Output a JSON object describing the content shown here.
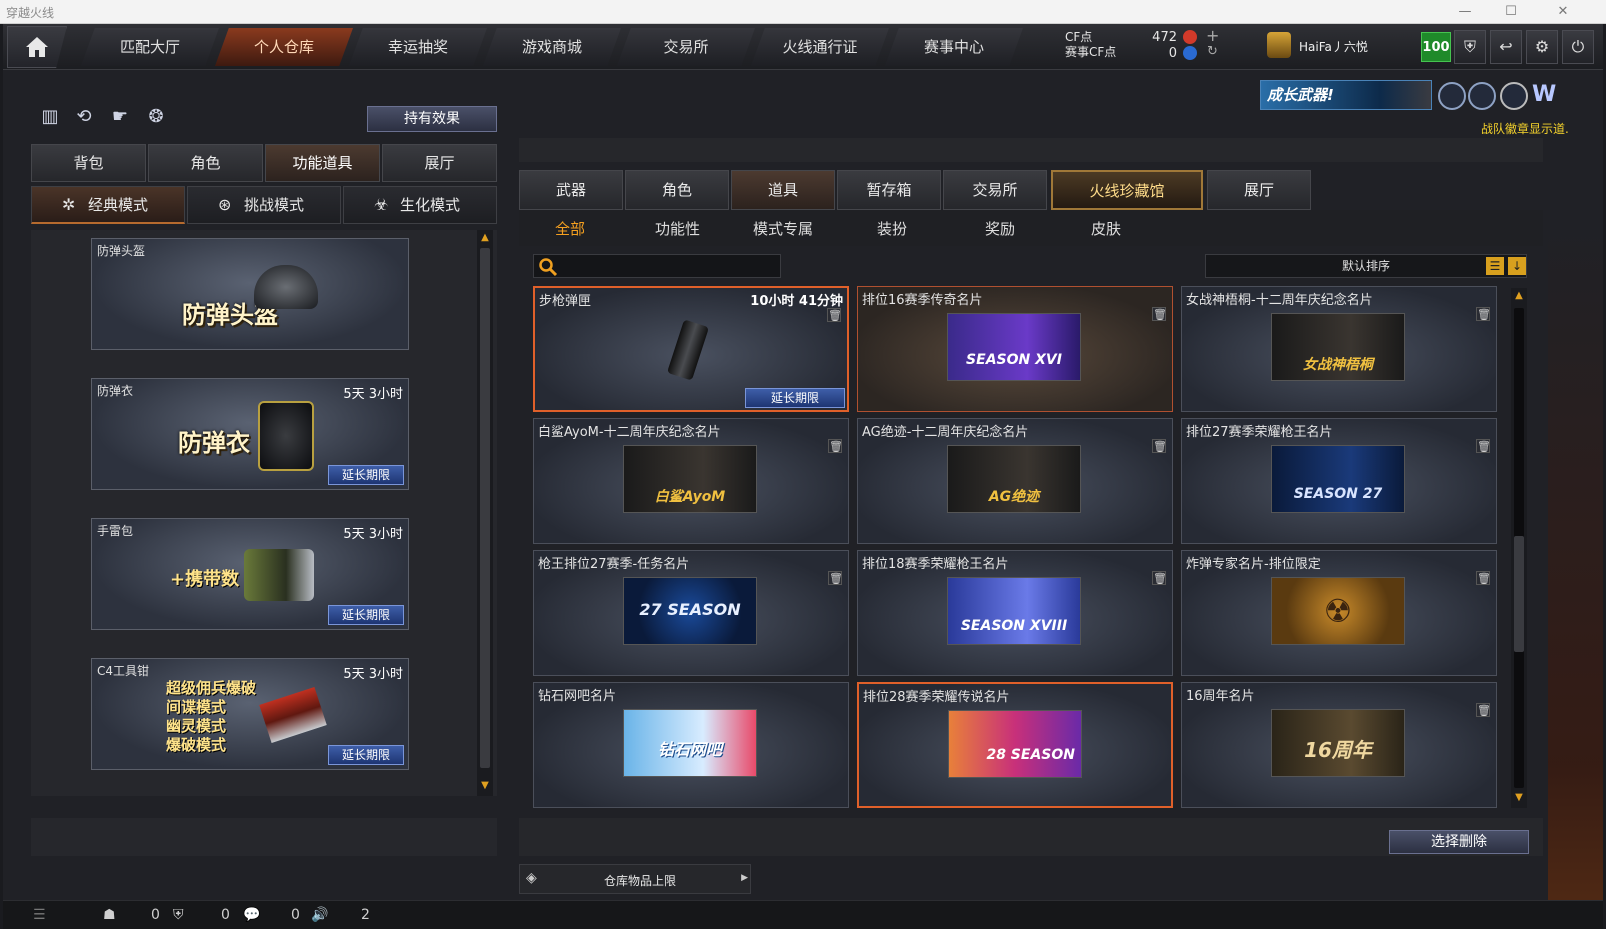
{
  "window": {
    "title": "穿越火线"
  },
  "topnav": {
    "tabs": [
      "匹配大厅",
      "个人仓库",
      "幸运抽奖",
      "游戏商城",
      "交易所",
      "火线通行证",
      "赛事中心"
    ],
    "active_index": 1,
    "currency": {
      "cf_label": "CF点",
      "cf_value": "472",
      "match_label": "赛事CF点",
      "match_value": "0"
    },
    "username": "HaiFa丿六悦",
    "vip_level": "100"
  },
  "promo": {
    "text": "成长武器!"
  },
  "notice": "战队徽章显示道.",
  "left": {
    "effect_button": "持有效果",
    "tabs": [
      "背包",
      "角色",
      "功能道具",
      "展厅"
    ],
    "active_tab": 2,
    "modes": [
      "经典模式",
      "挑战模式",
      "生化模式"
    ],
    "items": [
      {
        "name": "防弹头盔",
        "time": "",
        "art": "防弹头盔",
        "extend": ""
      },
      {
        "name": "防弹衣",
        "time": "5天 3小时",
        "art": "防弹衣",
        "extend": "延长期限"
      },
      {
        "name": "手雷包",
        "time": "5天 3小时",
        "art": "+携带数",
        "extend": "延长期限"
      },
      {
        "name": "C4工具钳",
        "time": "5天 3小时",
        "art_lines": [
          "超级佣兵爆破",
          "间谍模式",
          "幽灵模式",
          "爆破模式"
        ],
        "extend": "延长期限"
      }
    ]
  },
  "right": {
    "tabs": [
      "武器",
      "角色",
      "道具",
      "暂存箱",
      "交易所",
      "火线珍藏馆",
      "展厅"
    ],
    "active_tab": 2,
    "special_tab": 5,
    "subtabs": [
      "全部",
      "功能性",
      "模式专属",
      "装扮",
      "奖励",
      "皮肤"
    ],
    "active_subtab": 0,
    "search": {
      "placeholder": "",
      "value": ""
    },
    "sort": "默认排序",
    "cards": [
      {
        "name": "步枪弹匣",
        "time": "10小时 41分钟",
        "art": "",
        "extend": "延长期限"
      },
      {
        "name": "排位16赛季传奇名片",
        "art": "SEASON XVI"
      },
      {
        "name": "女战神梧桐-十二周年庆纪念名片",
        "art": "女战神梧桐"
      },
      {
        "name": "白鲨AyoM-十二周年庆纪念名片",
        "art": "白鲨AyoM"
      },
      {
        "name": "AG绝迹-十二周年庆纪念名片",
        "art": "AG绝迹"
      },
      {
        "name": "排位27赛季荣耀枪王名片",
        "art": "SEASON 27"
      },
      {
        "name": "枪王排位27赛季-任务名片",
        "art": "27 SEASON"
      },
      {
        "name": "排位18赛季荣耀枪王名片",
        "art": "SEASON XVIII"
      },
      {
        "name": "炸弹专家名片-排位限定",
        "art": ""
      },
      {
        "name": "钻石网吧名片",
        "art": "钻石网吧"
      },
      {
        "name": "排位28赛季荣耀传说名片",
        "art": "28 SEASON"
      },
      {
        "name": "16周年名片",
        "art": "16周年"
      }
    ],
    "delete_button": "选择删除",
    "capacity_label": "仓库物品上限"
  },
  "statusbar": {
    "a": "0",
    "b": "0",
    "c": "0",
    "d": "2"
  },
  "colors": {
    "accent": "#f5a020",
    "extend_blue": "#2e4a90",
    "notice": "#f4d22c",
    "vip": "#1f8a2a"
  }
}
